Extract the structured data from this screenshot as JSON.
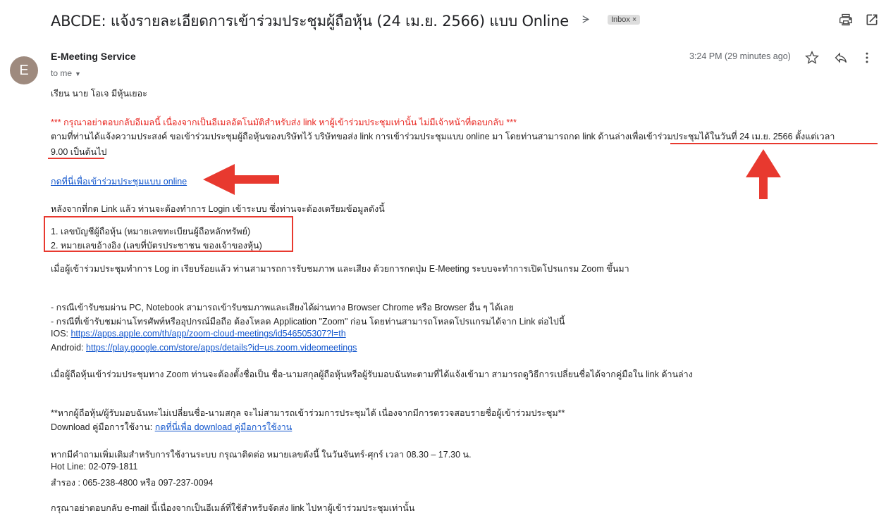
{
  "header": {
    "subject": "ABCDE: แจ้งรายละเอียดการเข้าร่วมประชุมผู้ถือหุ้น (24 เม.ย. 2566) แบบ Online",
    "label_chip": "Inbox",
    "label_chip_close": "×"
  },
  "sender": {
    "avatar_letter": "E",
    "name": "E-Meeting Service",
    "to": "to me",
    "time": "3:24 PM (29 minutes ago)"
  },
  "body": {
    "greeting": "เรียน นาย โอเจ มีหุ้นเยอะ",
    "warning": "*** กรุณาอย่าตอบกลับอีเมลนี้ เนื่องจากเป็นอีเมลอัตโนมัติสำหรับส่ง link หาผู้เข้าร่วมประชุมเท่านั้น ไม่มีเจ้าหน้าที่ตอบกลับ ***",
    "intro_line1": "ตามที่ท่านได้แจ้งความประสงค์ ขอเข้าร่วมประชุมผู้ถือหุ้นของบริษัทไว้ บริษัทขอส่ง link การเข้าร่วมประชุมแบบ online มา โดยท่านสามารถกด link ด้านล่างเพื่อเข้าร่วมประชุมได้ในวันที่ 24 เม.ย. 2566 ตั้งแต่เวลา",
    "intro_line2": "9.00 เป็นต้นไป",
    "join_link": "กดที่นี่เพื่อเข้าร่วมประชุมแบบ online",
    "after_link": "หลังจากที่กด Link แล้ว ท่านจะต้องทำการ Login เข้าระบบ ซึ่งท่านจะต้องเตรียมข้อมูลดังนี้",
    "req1": "1. เลขบัญชีผู้ถือหุ้น (หมายเลขทะเบียนผู้ถือหลักทรัพย์)",
    "req2": "2. หมายเลขอ้างอิง (เลขที่บัตรประชาชน ของเจ้าของหุ้น)",
    "after_login": "เมื่อผู้เข้าร่วมประชุมทำการ Log in เรียบร้อยแล้ว ท่านสามารถการรับชมภาพ และเสียง ด้วยการกดปุ่ม E-Meeting ระบบจะทำการเปิดโปรแกรม Zoom ขึ้นมา",
    "pc_line": "- กรณีเข้ารับชมผ่าน PC, Notebook สามารถเข้ารับชมภาพและเสียงได้ผ่านทาง Browser Chrome หรือ Browser อื่น ๆ ได้เลย",
    "mobile_line": "- กรณีที่เข้ารับชมผ่านโทรศัพท์หรืออุปกรณ์มือถือ ต้องโหลด Application \"Zoom\" ก่อน โดยท่านสามารถโหลดโปรแกรมได้จาก Link ต่อไปนี้",
    "ios_label": "IOS: ",
    "ios_link": "https://apps.apple.com/th/app/zoom-cloud-meetings/id546505307?l=th",
    "android_label": "Android: ",
    "android_link": "https://play.google.com/store/apps/details?id=us.zoom.videomeetings",
    "zoom_name": "เมื่อผู้ถือหุ้นเข้าร่วมประชุมทาง Zoom ท่านจะต้องตั้งชื่อเป็น ชื่อ-นามสกุลผู้ถือหุ้นหรือผู้รับมอบฉันทะตามที่ได้แจ้งเข้ามา สามารถดูวิธีการเปลี่ยนชื่อได้จากคู่มือใน link ด้านล่าง",
    "name_warning": "**หากผู้ถือหุ้น/ผู้รับมอบฉันทะไม่เปลี่ยนชื่อ-นามสกุล จะไม่สามารถเข้าร่วมการประชุมได้ เนื่องจากมีการตรวจสอบรายชื่อผู้เข้าร่วมประชุม**",
    "download_label": "Download คู่มือการใช้งาน: ",
    "download_link": "กดที่นี่เพื่อ download คู่มือการใช้งาน",
    "contact": "หากมีคำถามเพิ่มเติมสำหรับการใช้งานระบบ กรุณาติดต่อ หมายเลขดังนี้ ในวันจันทร์-ศุกร์ เวลา 08.30 – 17.30 น.",
    "hotline": "Hot Line: 02-079-1811",
    "backup": "สำรอง : 065-238-4800 หรือ 097-237-0094",
    "footer": "กรุณาอย่าตอบกลับ e-mail นี้เนื่องจากเป็นอีเมล์ที่ใช้สำหรับจัดส่ง link ไปหาผู้เข้าร่วมประชุมเท่านั้น"
  },
  "annotation_color": "#e8392f",
  "icons": [
    "importance-marker-icon",
    "print-icon",
    "open-in-new-window-icon",
    "star-icon",
    "reply-icon",
    "more-vert-icon",
    "chevron-down-icon",
    "red-arrow-left-icon",
    "red-arrow-up-icon"
  ]
}
